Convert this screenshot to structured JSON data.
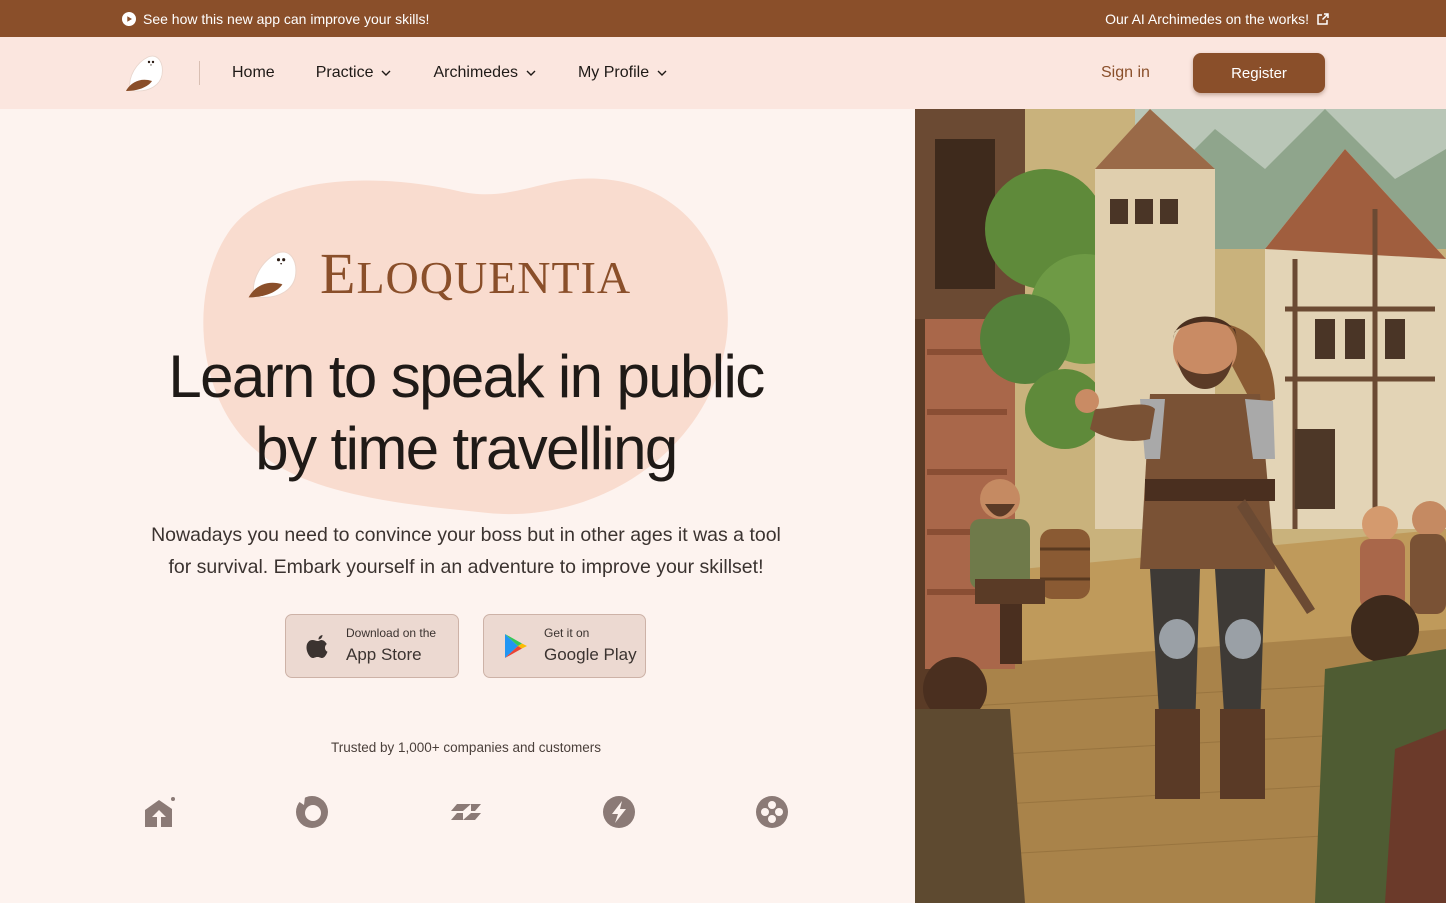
{
  "announcement": {
    "left_text": "See how this new app can improve your skills!",
    "right_text": "Our AI Archimedes on the works!",
    "left_icon": "play-circle-icon",
    "right_icon": "external-link-icon"
  },
  "nav": {
    "items": [
      {
        "label": "Home",
        "has_dropdown": false
      },
      {
        "label": "Practice",
        "has_dropdown": true
      },
      {
        "label": "Archimedes",
        "has_dropdown": true
      },
      {
        "label": "My Profile",
        "has_dropdown": true
      }
    ],
    "signin_label": "Sign in",
    "register_label": "Register"
  },
  "hero": {
    "brand_first": "E",
    "brand_rest": "LOQUENTIA",
    "headline_line1": "Learn to speak in public",
    "headline_line2": "by time travelling",
    "subtitle_line1": "Nowadays you need to convince your boss but in other ages it was a tool",
    "subtitle_line2": "for survival. Embark yourself in an adventure to improve your skillset!",
    "app_store": {
      "small": "Download on the",
      "big": "App Store",
      "icon": "apple-icon"
    },
    "google_play": {
      "small": "Get it on",
      "big": "Google Play",
      "icon": "google-play-icon"
    },
    "trusted_text": "Trusted by 1,000+ companies and customers",
    "partner_logos": [
      "house-logo-icon",
      "ring-logo-icon",
      "stripes-logo-icon",
      "bolt-logo-icon",
      "dots-logo-icon"
    ]
  },
  "colors": {
    "brand_brown": "#8a4f2a",
    "nav_bg": "#fbe6df",
    "page_bg": "#fdf3ef",
    "blob": "#f9dccf"
  }
}
